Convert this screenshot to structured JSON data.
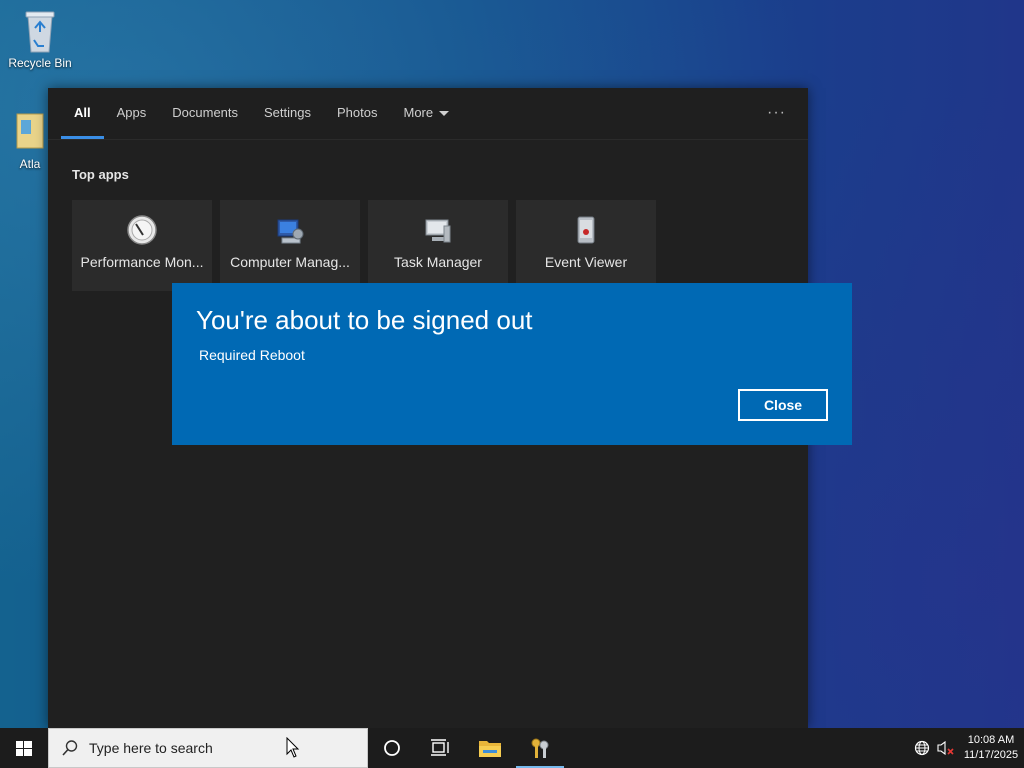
{
  "desktop": {
    "icons": [
      {
        "label": "Recycle Bin"
      },
      {
        "label": "Atla"
      }
    ]
  },
  "search": {
    "tabs": [
      {
        "label": "All",
        "active": true
      },
      {
        "label": "Apps"
      },
      {
        "label": "Documents"
      },
      {
        "label": "Settings"
      },
      {
        "label": "Photos"
      },
      {
        "label": "More"
      }
    ],
    "more_options": "···",
    "section_title": "Top apps",
    "top_apps": [
      {
        "label": "Performance Mon...",
        "icon": "performance-monitor-icon"
      },
      {
        "label": "Computer Manag...",
        "icon": "computer-management-icon"
      },
      {
        "label": "Task Manager",
        "icon": "task-manager-icon"
      },
      {
        "label": "Event Viewer",
        "icon": "event-viewer-icon"
      }
    ]
  },
  "dialog": {
    "title": "You're about to be signed out",
    "message": "Required Reboot",
    "close_label": "Close",
    "background": "#0069b4"
  },
  "taskbar": {
    "search_placeholder": "Type here to search",
    "clock_time": "10:08 AM",
    "clock_date": "11/17/2025",
    "accent": "#76b9ed"
  }
}
